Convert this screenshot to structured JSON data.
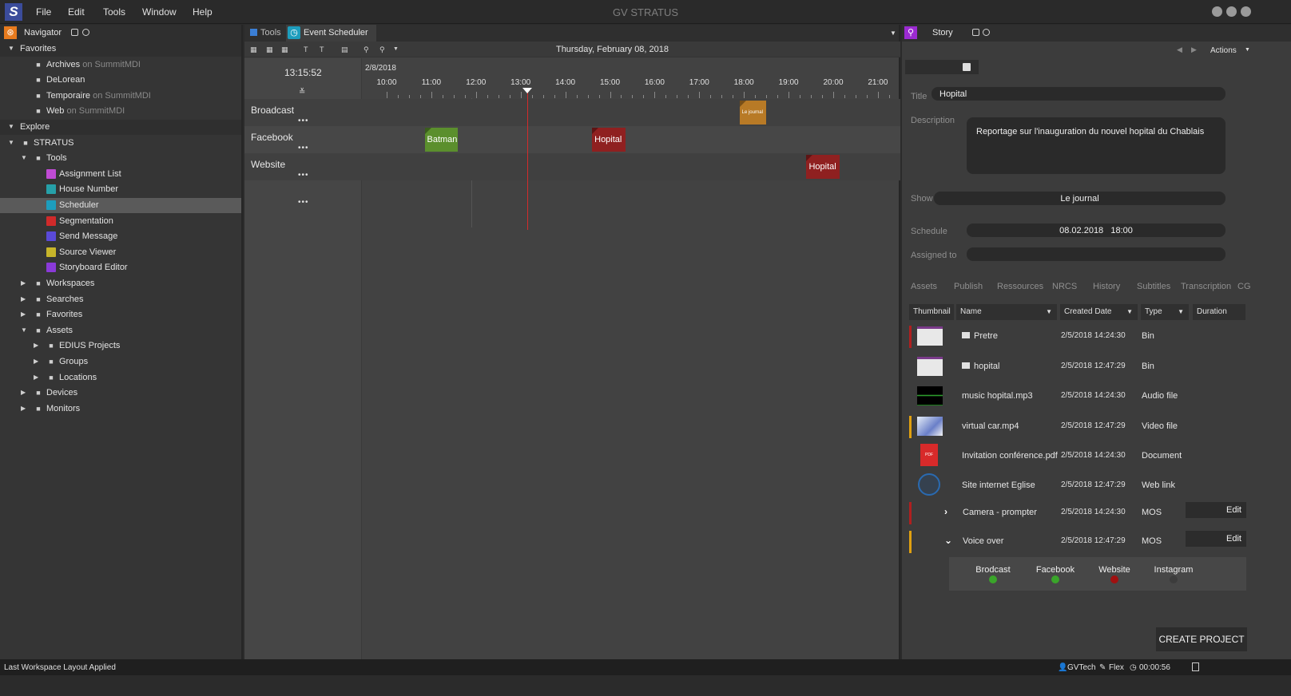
{
  "menubar": {
    "logo": "S",
    "items": [
      "File",
      "Edit",
      "Tools",
      "Window",
      "Help"
    ],
    "title": "GV STRATUS"
  },
  "navigator": {
    "header": "Navigator",
    "rows": [
      {
        "name": "Favorites",
        "type": "section",
        "caret": "▼"
      },
      {
        "name": "Archives",
        "suffix": "on SummitMDI",
        "icon": "folder-icon"
      },
      {
        "name": "DeLorean",
        "icon": "search-icon"
      },
      {
        "name": "Temporaire",
        "suffix": "on SummitMDI",
        "icon": "folder-icon"
      },
      {
        "name": "Web",
        "suffix": "on SummitMDI",
        "icon": "folder-icon"
      },
      {
        "name": "Explore",
        "type": "section",
        "caret": "▼"
      },
      {
        "name": "STRATUS",
        "caret": "▼",
        "icon": "monitor-icon"
      },
      {
        "name": "Tools",
        "caret": "▼",
        "icon": "wrench-icon"
      },
      {
        "name": "Assignment List",
        "icon": "assignment-list-icon"
      },
      {
        "name": "House Number",
        "icon": "house-number-icon"
      },
      {
        "name": "Scheduler",
        "icon": "scheduler-icon",
        "selected": true
      },
      {
        "name": "Segmentation",
        "icon": "segmentation-icon"
      },
      {
        "name": "Send Message",
        "icon": "send-message-icon"
      },
      {
        "name": "Source Viewer",
        "icon": "source-viewer-icon"
      },
      {
        "name": "Storyboard Editor",
        "icon": "storyboard-editor-icon"
      },
      {
        "name": "Workspaces",
        "caret": "▶",
        "icon": "workspaces-icon"
      },
      {
        "name": "Searches",
        "caret": "▶",
        "icon": "searches-icon"
      },
      {
        "name": "Favorites",
        "caret": "▶",
        "icon": "favorites-icon"
      },
      {
        "name": "Assets",
        "caret": "▼",
        "icon": "database-icon"
      },
      {
        "name": "EDIUS Projects",
        "caret": "▶",
        "icon": "edius-icon"
      },
      {
        "name": "Groups",
        "caret": "▶",
        "icon": "folder-icon"
      },
      {
        "name": "Locations",
        "caret": "▶",
        "icon": "folder-icon"
      },
      {
        "name": "Devices",
        "caret": "▶",
        "icon": "device-icon"
      },
      {
        "name": "Monitors",
        "caret": "▶",
        "icon": "monitors-icon"
      }
    ]
  },
  "scheduler": {
    "tab_tools": "Tools",
    "tab_active": "Event Scheduler",
    "date_header": "Thursday, February 08, 2018",
    "clock": "13:15:52",
    "day_label": "2/8/2018",
    "hours": [
      "10:00",
      "11:00",
      "12:00",
      "13:00",
      "14:00",
      "15:00",
      "16:00",
      "17:00",
      "18:00",
      "19:00",
      "20:00",
      "21:00"
    ],
    "now_hour": 13.15,
    "lanes": [
      {
        "name": "Broadcast",
        "dots": "•••"
      },
      {
        "name": "Facebook",
        "dots": "•••"
      },
      {
        "name": "Website",
        "dots": "•••"
      },
      {
        "name": "",
        "dots": "•••"
      }
    ],
    "events": [
      {
        "lane": 0,
        "label": "Le journal",
        "start": 17.9,
        "end": 18.5,
        "color": "#b87a26"
      },
      {
        "lane": 1,
        "label": "Batman",
        "start": 10.85,
        "end": 11.6,
        "color": "#5b8f2d"
      },
      {
        "lane": 1,
        "label": "Hopital",
        "start": 14.6,
        "end": 15.35,
        "color": "#8f2020"
      },
      {
        "lane": 2,
        "label": "Hopital",
        "start": 19.4,
        "end": 20.15,
        "color": "#8f2020"
      }
    ]
  },
  "story": {
    "header": "Story",
    "actions": "Actions",
    "title_label": "Title",
    "title_value": "Hopital",
    "description_label": "Description",
    "description_value": "Reportage sur l'inauguration du nouvel hopital du Chablais",
    "show_label": "Show",
    "show_value": "Le journal",
    "schedule_label": "Schedule",
    "schedule_value": "08.02.2018   18:00",
    "assigned_label": "Assigned to",
    "assigned_value": "",
    "asset_tabs": [
      "Assets",
      "Publish",
      "Ressources",
      "NRCS",
      "History",
      "Subtitles",
      "Transcription",
      "CG"
    ],
    "columns": [
      "Thumbnail",
      "Name",
      "Created Date",
      "Type",
      "Duration"
    ],
    "assets": [
      {
        "name": "Pretre",
        "date": "2/5/2018 14:24:30",
        "type": "Bin",
        "bar": "#b01f1f",
        "thumb": "folder"
      },
      {
        "name": "hopital",
        "date": "2/5/2018 12:47:29",
        "type": "Bin",
        "bar": "",
        "thumb": "folder"
      },
      {
        "name": "music hopital.mp3",
        "date": "2/5/2018 14:24:30",
        "type": "Audio file",
        "bar": "",
        "thumb": "audio"
      },
      {
        "name": "virtual car.mp4",
        "date": "2/5/2018 12:47:29",
        "type": "Video file",
        "bar": "#e0a010",
        "thumb": "video"
      },
      {
        "name": "Invitation conférence.pdf",
        "date": "2/5/2018 14:24:30",
        "type": "Document",
        "bar": "",
        "thumb": "pdf"
      },
      {
        "name": "Site internet Eglise",
        "date": "2/5/2018 12:47:29",
        "type": "Web link",
        "bar": "",
        "thumb": "globe"
      },
      {
        "name": "Camera - prompter",
        "date": "2/5/2018 14:24:30",
        "type": "MOS",
        "bar": "#b01f1f",
        "thumb": "chevron-right",
        "edit": "Edit"
      },
      {
        "name": "Voice over",
        "date": "2/5/2018 12:47:29",
        "type": "MOS",
        "bar": "#e0a010",
        "thumb": "chevron-down",
        "edit": "Edit"
      }
    ],
    "destinations": [
      {
        "name": "Brodcast",
        "color": "#3aa52a"
      },
      {
        "name": "Facebook",
        "color": "#3aa52a"
      },
      {
        "name": "Website",
        "color": "#a01010"
      },
      {
        "name": "Instagram",
        "color": "#3c3c3c"
      }
    ],
    "create_button": "CREATE PROJECT"
  },
  "statusbar": {
    "message": "Last Workspace Layout Applied",
    "user": "GVTech",
    "flex": "Flex",
    "timer": "00:00:56"
  }
}
